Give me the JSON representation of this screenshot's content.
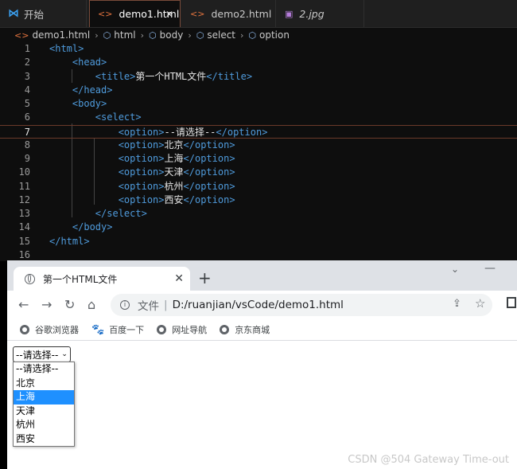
{
  "vscode": {
    "tabs": [
      {
        "label": "开始",
        "icon": "vscode-logo-icon"
      },
      {
        "label": "demo1.html",
        "icon": "html-file-icon",
        "active": true
      },
      {
        "label": "demo2.html",
        "icon": "html-file-icon"
      },
      {
        "label": "2.jpg",
        "icon": "image-file-icon"
      }
    ],
    "close_glyph": "✕",
    "breadcrumb": [
      "demo1.html",
      "html",
      "body",
      "select",
      "option"
    ],
    "code_lines": [
      {
        "n": "1",
        "indent": "",
        "parts": [
          [
            "tag",
            "<html>"
          ]
        ]
      },
      {
        "n": "2",
        "indent": "    ",
        "parts": [
          [
            "tag",
            "<head>"
          ]
        ]
      },
      {
        "n": "3",
        "indent": "        ",
        "parts": [
          [
            "tag",
            "<title>"
          ],
          [
            "txt",
            "第一个HTML文件"
          ],
          [
            "tag",
            "</title>"
          ]
        ]
      },
      {
        "n": "4",
        "indent": "    ",
        "parts": [
          [
            "tag",
            "</head>"
          ]
        ]
      },
      {
        "n": "5",
        "indent": "    ",
        "parts": [
          [
            "tag",
            "<body>"
          ]
        ]
      },
      {
        "n": "6",
        "indent": "        ",
        "parts": [
          [
            "tag",
            "<select>"
          ]
        ]
      },
      {
        "n": "7",
        "indent": "            ",
        "parts": [
          [
            "tag",
            "<option>"
          ],
          [
            "txt",
            "--请选择--"
          ],
          [
            "tag",
            "</option>"
          ]
        ],
        "current": true
      },
      {
        "n": "8",
        "indent": "            ",
        "parts": [
          [
            "tag",
            "<option>"
          ],
          [
            "txt",
            "北京"
          ],
          [
            "tag",
            "</option>"
          ]
        ]
      },
      {
        "n": "9",
        "indent": "            ",
        "parts": [
          [
            "tag",
            "<option>"
          ],
          [
            "txt",
            "上海"
          ],
          [
            "tag",
            "</option>"
          ]
        ]
      },
      {
        "n": "10",
        "indent": "            ",
        "parts": [
          [
            "tag",
            "<option>"
          ],
          [
            "txt",
            "天津"
          ],
          [
            "tag",
            "</option>"
          ]
        ]
      },
      {
        "n": "11",
        "indent": "            ",
        "parts": [
          [
            "tag",
            "<option>"
          ],
          [
            "txt",
            "杭州"
          ],
          [
            "tag",
            "</option>"
          ]
        ]
      },
      {
        "n": "12",
        "indent": "            ",
        "parts": [
          [
            "tag",
            "<option>"
          ],
          [
            "txt",
            "西安"
          ],
          [
            "tag",
            "</option>"
          ]
        ]
      },
      {
        "n": "13",
        "indent": "        ",
        "parts": [
          [
            "tag",
            "</select>"
          ]
        ]
      },
      {
        "n": "14",
        "indent": "    ",
        "parts": [
          [
            "tag",
            "</body>"
          ]
        ]
      },
      {
        "n": "15",
        "indent": "",
        "parts": [
          [
            "tag",
            "</html>"
          ]
        ]
      },
      {
        "n": "16",
        "indent": "",
        "parts": []
      }
    ],
    "colors": {
      "tag": "#4f9bdc",
      "text": "#e6e6e6",
      "active_tab_border": "#7a4b3a"
    }
  },
  "browser": {
    "tab_title": "第一个HTML文件",
    "tab_close": "✕",
    "new_tab": "+",
    "address": {
      "label": "文件",
      "separator": "|",
      "url": "D:/ruanjian/vsCode/demo1.html"
    },
    "nav": {
      "back": "←",
      "forward": "→",
      "reload": "↻",
      "home": "⌂",
      "star": "☆",
      "share": "⇪"
    },
    "window": {
      "chevron": "⌄",
      "minimize": "—"
    },
    "bookmarks": [
      {
        "label": "谷歌浏览器",
        "icon": "globe-icon"
      },
      {
        "label": "百度一下",
        "icon": "baidu-paw-icon"
      },
      {
        "label": "网址导航",
        "icon": "globe-icon"
      },
      {
        "label": "京东商城",
        "icon": "globe-icon"
      }
    ],
    "select": {
      "value": "--请选择--",
      "arrow": "⌄"
    },
    "options": [
      "--请选择--",
      "北京",
      "上海",
      "天津",
      "杭州",
      "西安"
    ],
    "highlighted_option": "上海",
    "highlight_color": "#1e90ff"
  },
  "watermark": "CSDN @504 Gateway Time-out"
}
